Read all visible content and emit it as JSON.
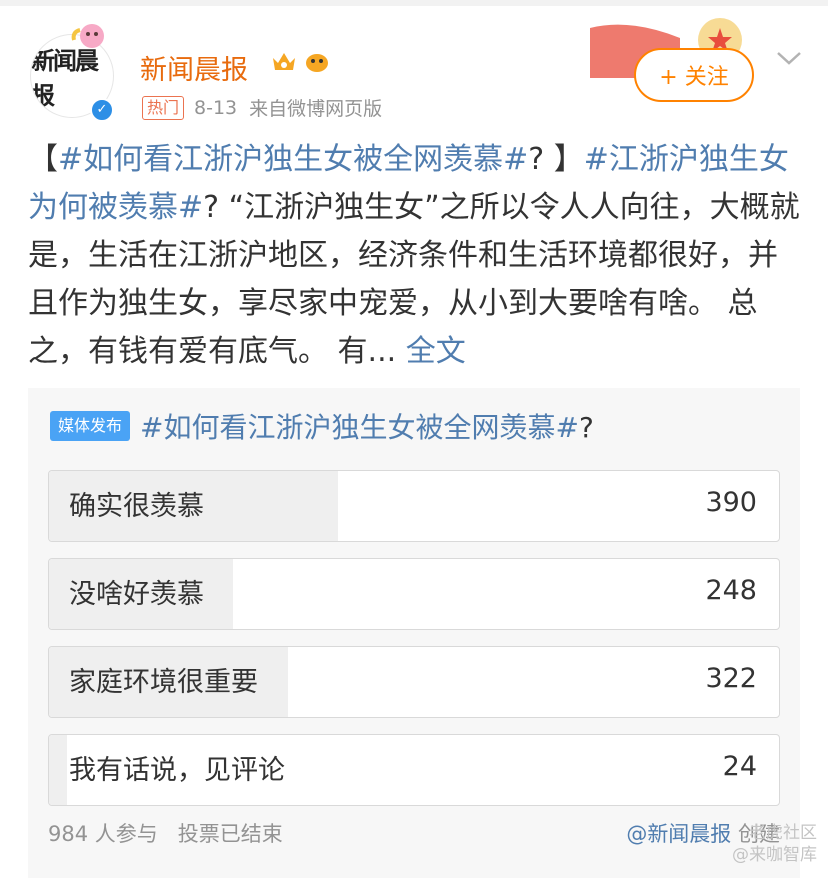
{
  "header": {
    "user_name": "新闻晨报",
    "hot_tag": "热门",
    "date": "8-13",
    "source": "来自微博网页版",
    "follow_label": "+ 关注",
    "avatar_text": "新闻晨报"
  },
  "post": {
    "segments": [
      {
        "text": "【",
        "topic": false
      },
      {
        "text": "#如何看江浙沪独生女被全网羡慕#",
        "topic": true
      },
      {
        "text": "? 】",
        "topic": false
      },
      {
        "text": "#江浙沪独生女为何被羡慕#",
        "topic": true
      },
      {
        "text": "? “江浙沪独生女”之所以令人人向往，大概就是，生活在江浙沪地区，经济条件和生活环境都很好，并且作为独生女，享尽家中宠爱，从小到大要啥有啥。 总之，有钱有爱有底气。 有...",
        "topic": false
      }
    ],
    "more_label": "全文"
  },
  "poll": {
    "media_tag": "媒体发布",
    "title": "#如何看江浙沪独生女被全网羡慕#",
    "title_suffix": "?",
    "options": [
      {
        "label": "确实很羡慕",
        "count": "390",
        "share": 0.396
      },
      {
        "label": "没啥好羡慕",
        "count": "248",
        "share": 0.252
      },
      {
        "label": "家庭环境很重要",
        "count": "322",
        "share": 0.327
      },
      {
        "label": "我有话说，见评论",
        "count": "24",
        "share": 0.024
      }
    ],
    "participants": "984 人参与",
    "status": "投票已结束",
    "creator_at": "@新闻晨报",
    "creator_suffix": " 创建"
  },
  "watermark": {
    "line1": "老虎社区",
    "line2": "@来咖智库"
  },
  "colors": {
    "accent_orange": "#ff8200",
    "link_blue": "#507daf",
    "media_tag_blue": "#4aa3f5"
  }
}
